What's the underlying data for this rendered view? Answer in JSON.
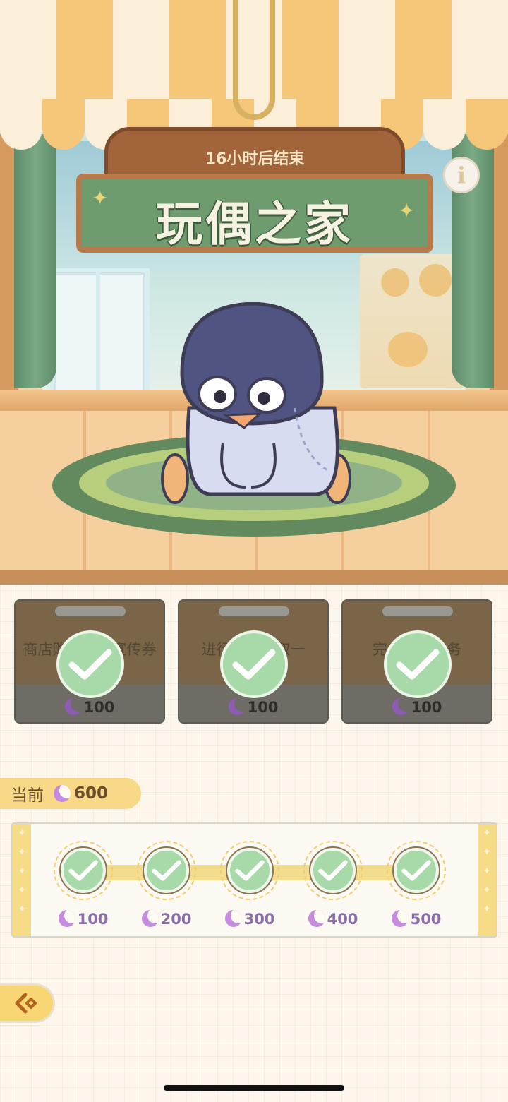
{
  "event": {
    "timer_text": "16小时后结束",
    "title": "玩偶之家"
  },
  "tasks": [
    {
      "text": "商店购买高级宣传券",
      "reward": "100",
      "completed": true
    },
    {
      "text": "进行替身获取一",
      "reward": "100",
      "completed": true
    },
    {
      "text": "完成委托任务",
      "reward": "100",
      "completed": true
    }
  ],
  "current": {
    "label": "当前",
    "value": "600"
  },
  "milestones": [
    {
      "value": "100",
      "claimed": true
    },
    {
      "value": "200",
      "claimed": true
    },
    {
      "value": "300",
      "claimed": true
    },
    {
      "value": "400",
      "claimed": true
    },
    {
      "value": "500",
      "claimed": true
    }
  ],
  "icons": {
    "info": "info-icon",
    "currency": "moon-icon",
    "check": "check-icon",
    "back": "back-arrow-icon"
  },
  "colors": {
    "check_fill": "#a8d9a8",
    "currency": "#8d5cb5",
    "sign_board": "#6f9c6e",
    "current_pill": "#f8d987"
  }
}
